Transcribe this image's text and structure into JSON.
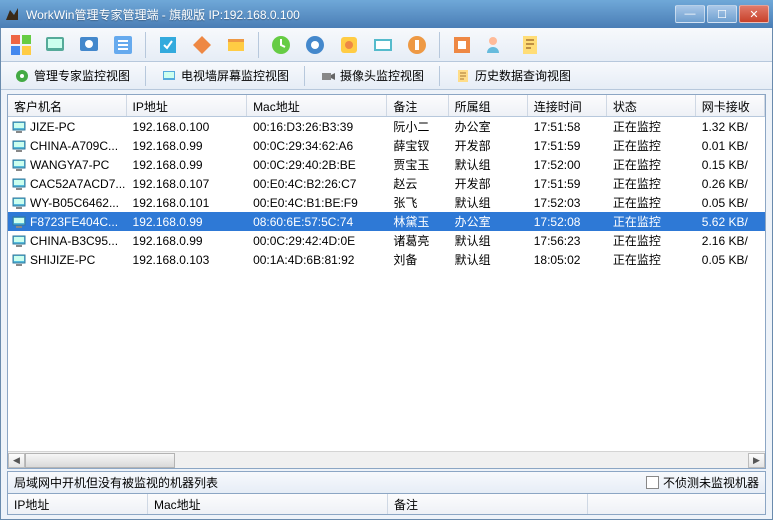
{
  "window": {
    "title": "WorkWin管理专家管理端 - 旗舰版 IP:192.168.0.100"
  },
  "tabs": {
    "t1": "管理专家监控视图",
    "t2": "电视墙屏幕监控视图",
    "t3": "摄像头监控视图",
    "t4": "历史数据查询视图"
  },
  "columns": {
    "c0": "客户机名",
    "c1": "IP地址",
    "c2": "Mac地址",
    "c3": "备注",
    "c4": "所属组",
    "c5": "连接时间",
    "c6": "状态",
    "c7": "网卡接收"
  },
  "rows": [
    {
      "name": "JIZE-PC",
      "ip": "192.168.0.100",
      "mac": "00:16:D3:26:B3:39",
      "remark": "阮小二",
      "group": "办公室",
      "time": "17:51:58",
      "status": "正在监控",
      "net": "1.32 KB/"
    },
    {
      "name": "CHINA-A709C...",
      "ip": "192.168.0.99",
      "mac": "00:0C:29:34:62:A6",
      "remark": "薛宝钗",
      "group": "开发部",
      "time": "17:51:59",
      "status": "正在监控",
      "net": "0.01 KB/"
    },
    {
      "name": "WANGYA7-PC",
      "ip": "192.168.0.99",
      "mac": "00:0C:29:40:2B:BE",
      "remark": "贾宝玉",
      "group": "默认组",
      "time": "17:52:00",
      "status": "正在监控",
      "net": "0.15 KB/"
    },
    {
      "name": "CAC52A7ACD7...",
      "ip": "192.168.0.107",
      "mac": "00:E0:4C:B2:26:C7",
      "remark": "赵云",
      "group": "开发部",
      "time": "17:51:59",
      "status": "正在监控",
      "net": "0.26 KB/"
    },
    {
      "name": "WY-B05C6462...",
      "ip": "192.168.0.101",
      "mac": "00:E0:4C:B1:BE:F9",
      "remark": "张飞",
      "group": "默认组",
      "time": "17:52:03",
      "status": "正在监控",
      "net": "0.05 KB/"
    },
    {
      "name": "F8723FE404C...",
      "ip": "192.168.0.99",
      "mac": "08:60:6E:57:5C:74",
      "remark": "林黛玉",
      "group": "办公室",
      "time": "17:52:08",
      "status": "正在监控",
      "net": "5.62 KB/",
      "selected": true
    },
    {
      "name": "CHINA-B3C95...",
      "ip": "192.168.0.99",
      "mac": "00:0C:29:42:4D:0E",
      "remark": "诸葛亮",
      "group": "默认组",
      "time": "17:56:23",
      "status": "正在监控",
      "net": "2.16 KB/"
    },
    {
      "name": "SHIJIZE-PC",
      "ip": "192.168.0.103",
      "mac": "00:1A:4D:6B:81:92",
      "remark": "刘备",
      "group": "默认组",
      "time": "18:05:02",
      "status": "正在监控",
      "net": "0.05 KB/"
    }
  ],
  "bottom": {
    "label": "局域网中开机但没有被监视的机器列表",
    "checkbox": "不侦测未监视机器",
    "h0": "IP地址",
    "h1": "Mac地址",
    "h2": "备注"
  }
}
